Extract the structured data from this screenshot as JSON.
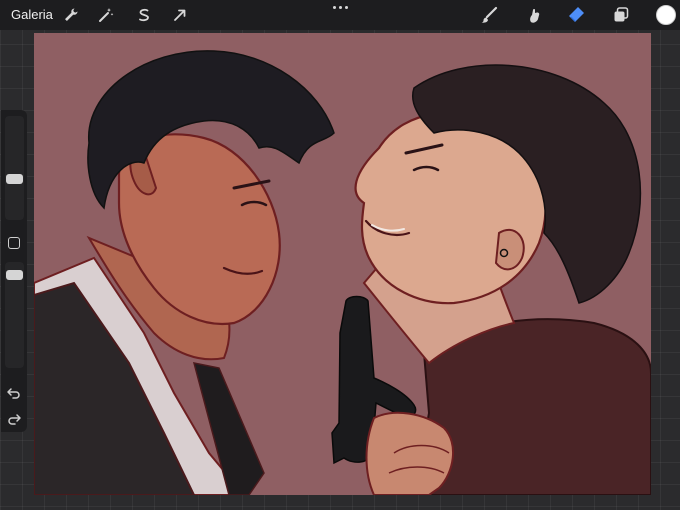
{
  "toolbar": {
    "gallery_label": "Galeria",
    "left_tools": [
      "wrench-icon",
      "magic-wand-icon",
      "selection-icon",
      "transform-arrow-icon"
    ],
    "more_menu": "more-dots-icon",
    "right_tools": [
      "brush-icon",
      "smudge-icon",
      "eraser-icon",
      "layers-icon"
    ],
    "active_tool": "eraser",
    "active_tool_color": "#4e8ef7",
    "current_color": "#ffffff"
  },
  "sidebar": {
    "brush_size_level": 0.4,
    "opacity_level": 0.1,
    "modify_button": "square-icon",
    "undo_icon": "undo-icon",
    "redo_icon": "redo-icon"
  },
  "canvas": {
    "background_color": "#8f5f63",
    "artwork_description_icon": "illustration"
  }
}
